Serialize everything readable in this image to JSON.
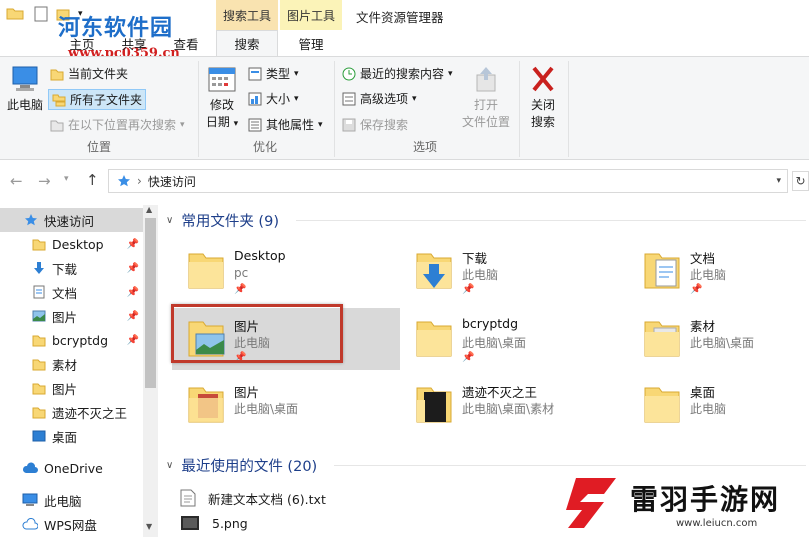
{
  "window": {
    "title": "文件资源管理器",
    "ribbon_tabs": [
      "主页",
      "共享",
      "查看",
      "搜索",
      "管理"
    ],
    "context_tabs": {
      "search_tools": "搜索工具",
      "picture_tools": "图片工具"
    }
  },
  "watermark_top": {
    "name": "河东软件园",
    "url": "www.pc0359.cn"
  },
  "ribbon": {
    "location": {
      "this_pc": "此电脑",
      "current_folder": "当前文件夹",
      "all_subfolders": "所有子文件夹",
      "search_again": "在以下位置再次搜索",
      "label": "位置"
    },
    "refine": {
      "date_modified_1": "修改",
      "date_modified_2": "日期",
      "kind": "类型",
      "size": "大小",
      "other_props": "其他属性",
      "label": "优化"
    },
    "options": {
      "recent": "最近的搜索内容",
      "advanced": "高级选项",
      "save": "保存搜索",
      "open_loc_1": "打开",
      "open_loc_2": "文件位置",
      "close_1": "关闭",
      "close_2": "搜索",
      "label": "选项"
    }
  },
  "address": {
    "crumb": "快速访问"
  },
  "sidebar": {
    "items": [
      {
        "label": "快速访问",
        "icon": "star-icon"
      },
      {
        "label": "Desktop",
        "icon": "folder-icon",
        "pinned": true
      },
      {
        "label": "下载",
        "icon": "download-icon",
        "pinned": true
      },
      {
        "label": "文档",
        "icon": "document-icon",
        "pinned": true
      },
      {
        "label": "图片",
        "icon": "picture-icon",
        "pinned": true
      },
      {
        "label": "bcryptdg",
        "icon": "folder-icon",
        "pinned": true
      },
      {
        "label": "素材",
        "icon": "folder-icon"
      },
      {
        "label": "图片",
        "icon": "folder-icon"
      },
      {
        "label": "遗迹不灭之王",
        "icon": "folder-icon"
      },
      {
        "label": "桌面",
        "icon": "desktop-icon"
      },
      {
        "label": "OneDrive",
        "icon": "cloud-icon"
      },
      {
        "label": "此电脑",
        "icon": "computer-icon"
      },
      {
        "label": "WPS网盘",
        "icon": "wps-cloud-icon"
      }
    ]
  },
  "frequent": {
    "heading": "常用文件夹 (9)",
    "tiles": [
      {
        "name": "Desktop",
        "sub": "pc",
        "pinned": true
      },
      {
        "name": "下载",
        "sub": "此电脑",
        "pinned": true
      },
      {
        "name": "文档",
        "sub": "此电脑",
        "pinned": true
      },
      {
        "name": "图片",
        "sub": "此电脑",
        "pinned": true
      },
      {
        "name": "bcryptdg",
        "sub": "此电脑\\桌面",
        "pinned": true
      },
      {
        "name": "素材",
        "sub": "此电脑\\桌面",
        "pinned": false
      },
      {
        "name": "图片",
        "sub": "此电脑\\桌面",
        "pinned": false
      },
      {
        "name": "遗迹不灭之王",
        "sub": "此电脑\\桌面\\素材",
        "pinned": false
      },
      {
        "name": "桌面",
        "sub": "此电脑",
        "pinned": false
      }
    ]
  },
  "recent": {
    "heading": "最近使用的文件 (20)",
    "files": [
      {
        "name": "新建文本文档 (6).txt",
        "icon": "text-file-icon"
      },
      {
        "name": "5.png",
        "icon": "image-file-icon"
      }
    ]
  },
  "watermark_bottom": {
    "name": "雷羽手游网",
    "url": "www.leiucn.com"
  },
  "colors": {
    "accent": "#1e6ec9",
    "highlight_border": "#c0392b",
    "folder": "#f8d775"
  }
}
